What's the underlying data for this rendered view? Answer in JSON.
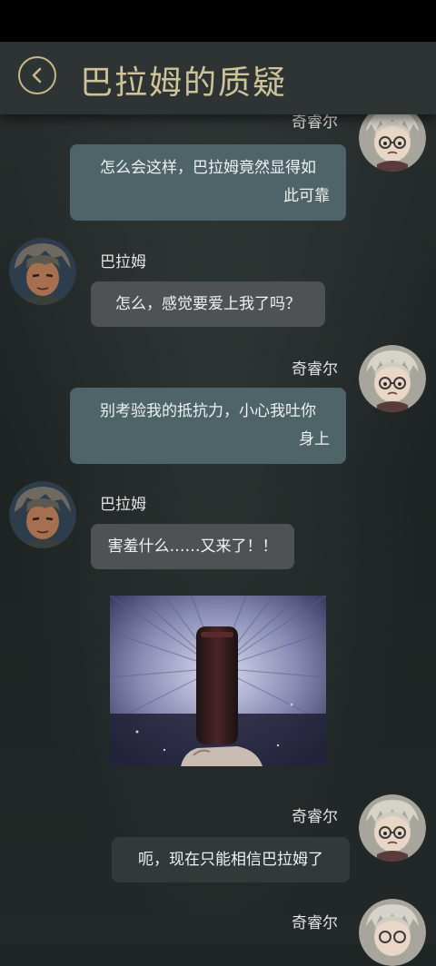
{
  "header": {
    "title": "巴拉姆的质疑"
  },
  "messages": [
    {
      "sender": "奇睿尔",
      "side": "right",
      "text": "怎么会这样，巴拉姆竟然显得如此可靠",
      "lines": [
        "怎么会这样，巴拉姆竟然显得如",
        "此可靠"
      ]
    },
    {
      "sender": "巴拉姆",
      "side": "left",
      "text": "怎么，感觉要爱上我了吗？"
    },
    {
      "sender": "奇睿尔",
      "side": "right",
      "text": "别考验我的抵抗力，小心我吐你身上",
      "lines": [
        "别考验我的抵抗力，小心我吐你",
        "身上"
      ]
    },
    {
      "sender": "巴拉姆",
      "side": "left",
      "text": "害羞什么……又来了！！"
    },
    {
      "type": "image",
      "description": "gun-barrel-image"
    },
    {
      "sender": "奇睿尔",
      "side": "right",
      "text": "呃，现在只能相信巴拉姆了"
    },
    {
      "sender": "奇睿尔",
      "side": "right",
      "text": ""
    }
  ],
  "colors": {
    "title": "#cfc39a",
    "bubble_me": "#4f6468",
    "bubble_other": "#4e5254",
    "background": "#1f2524"
  }
}
